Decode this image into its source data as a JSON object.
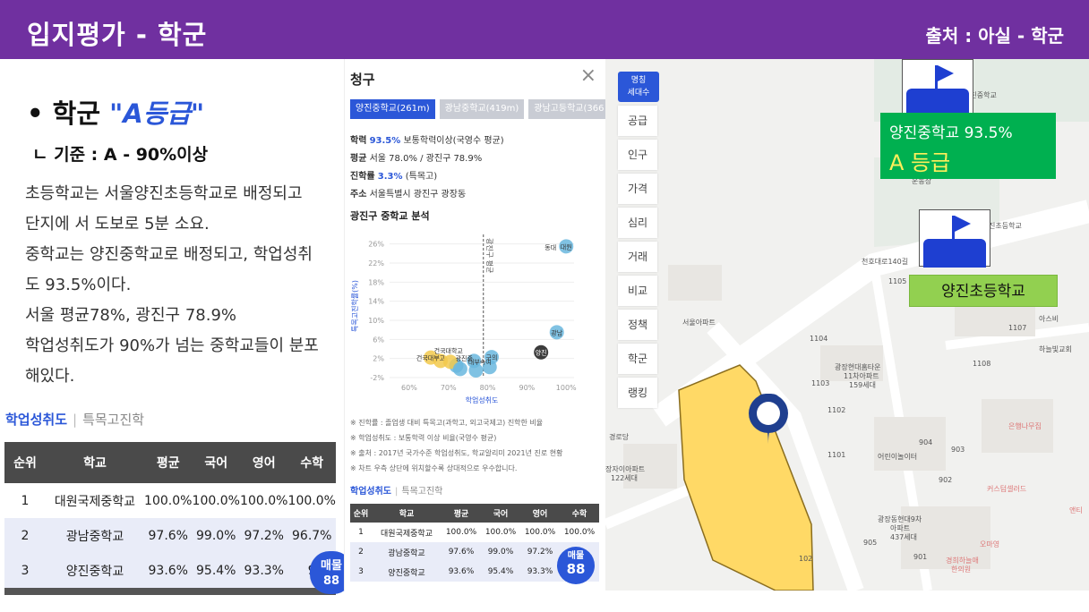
{
  "slide": {
    "title": "입지평가 - 학군",
    "source": "출처 : 아실 - 학군",
    "heading_bullet": "•",
    "heading_prefix": "학군",
    "heading_grade": "\"A등급\"",
    "criteria": "ㄴ 기준 : A - 90%이상",
    "description": [
      "초등학교는 서울양진초등학교로 배정되고",
      "단지에 서 도보로  5분 소요.",
      "중학교는 양진중학교로 배정되고, 학업성취",
      "도 93.5%이다.",
      "서울 평균78%, 광진구 78.9%",
      "학업성취도가 90%가 넘는 중학교들이 분포",
      "해있다."
    ]
  },
  "left_table": {
    "tab_active": "학업성취도",
    "tab_sep": "|",
    "tab_inactive": "특목고진학",
    "headers": [
      "순위",
      "학교",
      "평균",
      "국어",
      "영어",
      "수학"
    ],
    "rows": [
      [
        "1",
        "대원국제중학교",
        "100.0%",
        "100.0%",
        "100.0%",
        "100.0%"
      ],
      [
        "2",
        "광남중학교",
        "97.6%",
        "99.0%",
        "97.2%",
        "96.7%"
      ],
      [
        "3",
        "양진중학교",
        "93.6%",
        "95.4%",
        "93.3%",
        "9"
      ]
    ],
    "bubble_label": "매물",
    "bubble_value": "88"
  },
  "detail_panel": {
    "title": "청구",
    "close_icon": "×",
    "tabs": [
      "양진중학교(261m)",
      "광남중학교(419m)",
      "광남고등학교(366"
    ],
    "info": {
      "achievement_label": "학력",
      "achievement_value": "93.5%",
      "achievement_note": "보통학력이상(국영수 평균)",
      "avg_label": "평균",
      "avg_value": "서울 78.0% / 광진구 78.9%",
      "advance_label": "진학률",
      "advance_value": "3.3%",
      "advance_note": "(특목고)",
      "address_label": "주소",
      "address_value": "서울특별시 광진구 광장동"
    },
    "analysis_title": "광진구 중학교 분석",
    "notes": [
      "※ 진학률 : 졸업생 대비 특목고(과학고, 외고국제고) 진학한 비율",
      "※ 학업성취도 : 보통학력 이상 비율(국영수 평균)",
      "※ 출처 : 2017년 국가수준 학업성취도, 학교알리미 2021년 진로 현황",
      "※ 차트 우측 상단에 위치할수록 상대적으로 우수합니다."
    ],
    "table_tab_active": "학업성취도",
    "table_tab_sep": "|",
    "table_tab_inactive": "특목고진학",
    "table_headers": [
      "순위",
      "학교",
      "평균",
      "국어",
      "영어",
      "수학"
    ],
    "table_rows": [
      [
        "1",
        "대원국제중학교",
        "100.0%",
        "100.0%",
        "100.0%",
        "100.0%"
      ],
      [
        "2",
        "광남중학교",
        "97.6%",
        "99.0%",
        "97.2%",
        "96."
      ],
      [
        "3",
        "양진중학교",
        "93.6%",
        "95.4%",
        "93.3%",
        "9"
      ]
    ],
    "bubble_label": "매물",
    "bubble_value": "88"
  },
  "chart_data": {
    "type": "scatter",
    "title": "광진구 중학교 분석",
    "xlabel": "학업성취도",
    "ylabel": "특목고진학률(%)",
    "xlim": [
      55,
      102
    ],
    "ylim": [
      -2,
      28
    ],
    "x_ticks": [
      "60%",
      "70%",
      "80%",
      "90%",
      "100%"
    ],
    "y_ticks": [
      "26%",
      "22%",
      "18%",
      "14%",
      "10%",
      "6%",
      "2%",
      "-2%"
    ],
    "x_tick_values": [
      60,
      70,
      80,
      90,
      100
    ],
    "y_tick_values": [
      26,
      22,
      18,
      14,
      10,
      6,
      2,
      -2
    ],
    "reference_line": {
      "x": 78.9,
      "label": "광진구 평균"
    },
    "points": [
      {
        "x": 100,
        "y": 25.5,
        "label": "대원",
        "color": "#6ab7de"
      },
      {
        "x": 97.6,
        "y": 7.5,
        "label": "광남",
        "color": "#6ab7de"
      },
      {
        "x": 93.6,
        "y": 3.3,
        "label": "양진",
        "color": "#1a1a1a"
      },
      {
        "x": 81,
        "y": 2.3,
        "label": "구의",
        "color": "#6ab7de"
      },
      {
        "x": 76.5,
        "y": 1.5,
        "label": "",
        "color": "#6ab7de"
      },
      {
        "x": 72,
        "y": 0.5,
        "label": "",
        "color": "#6ab7de"
      },
      {
        "x": 68,
        "y": 1.5,
        "label": "",
        "color": "#f2c94c"
      },
      {
        "x": 65.5,
        "y": 2.2,
        "label": "건국대부고",
        "color": "#f2c94c"
      },
      {
        "x": 70.5,
        "y": 1.3,
        "label": "",
        "color": "#f2c94c"
      },
      {
        "x": 77,
        "y": -0.5,
        "label": "",
        "color": "#6ab7de"
      },
      {
        "x": 73,
        "y": -0.2,
        "label": "",
        "color": "#6ab7de"
      },
      {
        "x": 80.5,
        "y": 0.2,
        "label": "",
        "color": "#6ab7de"
      }
    ],
    "extra_labels": [
      "건국대학교",
      "광진중",
      "동대",
      "대부속여"
    ]
  },
  "map": {
    "badge_line1": "명칭",
    "badge_line2": "세대수",
    "tools": [
      "공급",
      "인구",
      "가격",
      "심리",
      "거래",
      "비교",
      "정책",
      "학군",
      "랭킹"
    ],
    "labels": [
      {
        "text": "양진중학교"
      },
      {
        "text": "운동장"
      },
      {
        "text": "진초등학교"
      },
      {
        "text": "천호대로140길"
      },
      {
        "text": "서울아파트"
      },
      {
        "text": "아스비"
      },
      {
        "text": "하늘빛교회"
      },
      {
        "text": "광장현대홈타운"
      },
      {
        "text": "11차아파트"
      },
      {
        "text": "159세대"
      },
      {
        "text": "은행나무집"
      },
      {
        "text": "경로당"
      },
      {
        "text": "장자이아파트"
      },
      {
        "text": "122세대"
      },
      {
        "text": "어린이놀이터"
      },
      {
        "text": "커스텀셀러드"
      },
      {
        "text": "광장동현대9차"
      },
      {
        "text": "아파트"
      },
      {
        "text": "437세대"
      },
      {
        "text": "오마영"
      },
      {
        "text": "경희하늘애"
      },
      {
        "text": "한의원"
      },
      {
        "text": "앤티"
      }
    ],
    "numbers": [
      "1105",
      "1107",
      "1104",
      "1108",
      "1103",
      "1102",
      "1101",
      "904",
      "903",
      "902",
      "901",
      "905",
      "102"
    ],
    "callout_school": "양진중학교 93.5%",
    "callout_grade": "A 등급",
    "callout_elementary": "양진초등학교"
  },
  "colors": {
    "title_bar": "#7030a0",
    "accent_blue": "#2b57d8",
    "grade_green": "#00b050",
    "elem_green": "#92d050",
    "site_yellow": "#ffd966",
    "pin_navy": "#1f3f8f"
  }
}
